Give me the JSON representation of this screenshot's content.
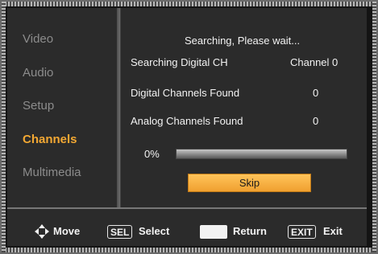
{
  "sidebar": {
    "items": [
      {
        "label": "Video",
        "active": false
      },
      {
        "label": "Audio",
        "active": false
      },
      {
        "label": "Setup",
        "active": false
      },
      {
        "label": "Channels",
        "active": true
      },
      {
        "label": "Multimedia",
        "active": false
      }
    ]
  },
  "scan": {
    "status": "Searching, Please wait...",
    "searching_label": "Searching Digital CH",
    "searching_value": "Channel 0",
    "digital_label": "Digital Channels Found",
    "digital_value": "0",
    "analog_label": "Analog Channels Found",
    "analog_value": "0",
    "progress_text": "0%",
    "progress_fraction": 0,
    "skip_label": "Skip"
  },
  "footer": {
    "move_label": "Move",
    "sel_key": "SEL",
    "select_label": "Select",
    "return_label": "Return",
    "exit_key": "EXIT",
    "exit_label": "Exit"
  },
  "colors": {
    "accent": "#f3a833",
    "panel": "#2b2b2b",
    "text": "#f2f2f2",
    "muted": "#8c8c8c"
  }
}
